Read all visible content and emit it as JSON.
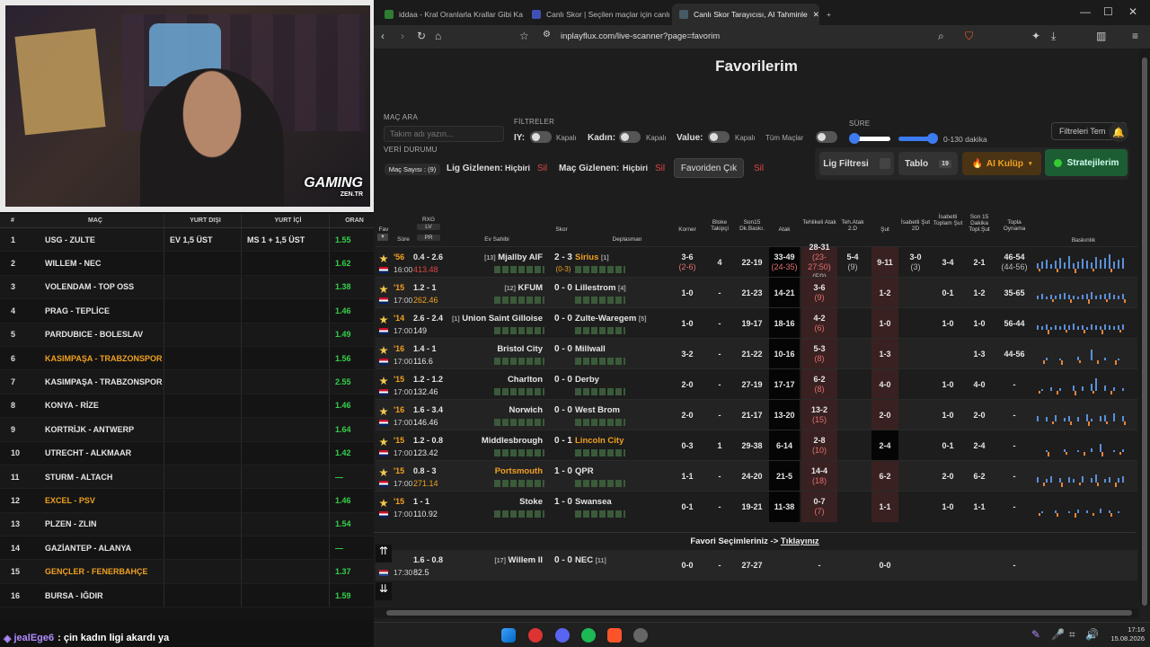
{
  "browser": {
    "tabs": [
      {
        "title": "iddaa - Kral Oranlarla Krallar Gibi Ka",
        "color": "#2e7d32"
      },
      {
        "title": "Canlı Skor | Seçilen maçlar için canlı",
        "color": "#3f51b5"
      },
      {
        "title": "Canlı Skor Tarayıcısı, AI Tahminle",
        "color": "#37474f"
      }
    ],
    "url": "inplayflux.com/live-scanner?page=favorim"
  },
  "left_table": {
    "headers": {
      "num": "#",
      "match": "MAÇ",
      "away": "YURT DIŞI",
      "home": "YURT İÇİ",
      "odds": "ORAN"
    },
    "rows": [
      {
        "n": "1",
        "match": "USG - ZULTE",
        "yd": "EV 1,5 ÜST",
        "yi": "MS 1 + 1,5 ÜST",
        "odd": "1.55",
        "hl": false
      },
      {
        "n": "2",
        "match": "WILLEM - NEC",
        "yd": "",
        "yi": "",
        "odd": "1.62",
        "hl": false
      },
      {
        "n": "3",
        "match": "VOLENDAM - TOP OSS",
        "yd": "",
        "yi": "",
        "odd": "1.38",
        "hl": false
      },
      {
        "n": "4",
        "match": "PRAG - TEPLİCE",
        "yd": "",
        "yi": "",
        "odd": "1.46",
        "hl": false
      },
      {
        "n": "5",
        "match": "PARDUBICE - BOLESLAV",
        "yd": "",
        "yi": "",
        "odd": "1.49",
        "hl": false
      },
      {
        "n": "6",
        "match": "KASIMPAŞA - TRABZONSPOR",
        "yd": "",
        "yi": "",
        "odd": "1.56",
        "hl": true
      },
      {
        "n": "7",
        "match": "KASIMPAŞA - TRABZONSPOR",
        "yd": "",
        "yi": "",
        "odd": "2.55",
        "hl": false
      },
      {
        "n": "8",
        "match": "KONYA - RİZE",
        "yd": "",
        "yi": "",
        "odd": "1.46",
        "hl": false
      },
      {
        "n": "9",
        "match": "KORTRİJK - ANTWERP",
        "yd": "",
        "yi": "",
        "odd": "1.64",
        "hl": false
      },
      {
        "n": "10",
        "match": "UTRECHT - ALKMAAR",
        "yd": "",
        "yi": "",
        "odd": "1.42",
        "hl": false
      },
      {
        "n": "11",
        "match": "STURM - ALTACH",
        "yd": "",
        "yi": "",
        "odd": "—",
        "hl": false
      },
      {
        "n": "12",
        "match": "EXCEL - PSV",
        "yd": "",
        "yi": "",
        "odd": "1.46",
        "hl": true
      },
      {
        "n": "13",
        "match": "PLZEN - ZLIN",
        "yd": "",
        "yi": "",
        "odd": "1.54",
        "hl": false
      },
      {
        "n": "14",
        "match": "GAZİANTEP - ALANYA",
        "yd": "",
        "yi": "",
        "odd": "—",
        "hl": false
      },
      {
        "n": "15",
        "match": "GENÇLER - FENERBAHÇE",
        "yd": "",
        "yi": "",
        "odd": "1.37",
        "hl": true
      },
      {
        "n": "16",
        "match": "BURSA - IĞDIR",
        "yd": "",
        "yi": "",
        "odd": "1.59",
        "hl": false
      }
    ]
  },
  "chat": {
    "user": "jealEge6",
    "message": ": çin kadın ligi akardı ya"
  },
  "page": {
    "title": "Favorilerim",
    "search_label": "MAÇ ARA",
    "search_placeholder": "Takım adı yazın...",
    "filters_label": "FİLTRELER",
    "filter_iy": "IY:",
    "filter_kadin": "Kadın:",
    "filter_value": "Value:",
    "off": "Kapalı",
    "all_matches": "Tüm Maçlar",
    "duration_label": "SÜRE",
    "duration_value": "0-130 dakika",
    "reset_filters": "Filtreleri Tem",
    "data_status": "VERİ DURUMU",
    "match_count": "Maç Sayısı : (9)",
    "league_hidden": "Lig Gizlenen:",
    "match_hidden": "Maç Gizlenen:",
    "none": "Hiçbiri",
    "delete": "Sil",
    "remove_fav": "Favoriden Çık",
    "league_filter": "Lig Filtresi",
    "table_btn": "Tablo",
    "table_count": "19",
    "ai_club": "AI Kulüp",
    "strategies": "Stratejilerim",
    "favorite_link_text": "Favori Seçimleriniz ->",
    "favorite_link": "Tıklayınız"
  },
  "columns": {
    "fav": "Fav",
    "sure": "Süre",
    "rxg": "RXG",
    "lv": "LV",
    "pr": "PR",
    "home": "Ev Sahibi",
    "score": "Skor",
    "away": "Deplasman",
    "corner": "Korner",
    "block": "Bloke Takipçi",
    "last15": "Son15 Dk.Baskı.",
    "attack": "Atak",
    "danger": "Tehlikeli Atak",
    "tehatak": "Teh.Atak 2.D",
    "shot": "Şut",
    "ontarget": "İsabetli Şut 2D",
    "ontotal": "İsabetli Toplam Şut",
    "last15shot": "Son 15 Dakika Topl.Şut",
    "possession": "Topla Oynama",
    "pressure": "Baskınlık"
  },
  "matches": [
    {
      "min": "'56",
      "time": "16:00",
      "rxg": "0.4 - 2.6",
      "rxgv": "413.48",
      "home": "Mjallby AIF",
      "hrank": "[13]",
      "score": "2 - 3",
      "ht": "(0-3)",
      "away": "Sirius",
      "arank": "[1]",
      "corner": "3-6",
      "corner2": "(2-6)",
      "block": "4",
      "last15": "22-19",
      "attack": "33-49",
      "attack2": "(24-35)",
      "danger": "28-31",
      "danger2": "(23-27:50)",
      "danger3": "(59)",
      "tehatak": "5-4",
      "tehatak2": "(9)",
      "shot": "9-11",
      "ontarget": "3-0",
      "ontarget2": "(3)",
      "ontotal": "3-4",
      "last15shot": "2-1",
      "poss": "46-54",
      "poss2": "(44-56)"
    },
    {
      "min": "'15",
      "time": "17:00",
      "rxg": "1.2 - 1",
      "rxgv": "262.46",
      "home": "KFUM",
      "hrank": "[12]",
      "score": "0 - 0",
      "ht": "",
      "away": "Lillestrom",
      "arank": "[4]",
      "corner": "1-0",
      "corner2": "",
      "block": "-",
      "last15": "21-23",
      "attack": "14-21",
      "attack2": "",
      "danger": "3-6",
      "danger2": "(9)",
      "danger3": "",
      "tehatak": "",
      "tehatak2": "",
      "shot": "1-2",
      "ontarget": "",
      "ontarget2": "",
      "ontotal": "0-1",
      "last15shot": "1-2",
      "poss": "35-65",
      "poss2": ""
    },
    {
      "min": "'14",
      "time": "17:00",
      "rxg": "2.6 - 2.4",
      "rxgv": "149",
      "home": "Union Saint Gilloise",
      "hrank": "[1]",
      "score": "0 - 0",
      "ht": "",
      "away": "Zulte-Waregem",
      "arank": "[5]",
      "corner": "1-0",
      "corner2": "",
      "block": "-",
      "last15": "19-17",
      "attack": "18-16",
      "attack2": "",
      "danger": "4-2",
      "danger2": "(6)",
      "danger3": "",
      "tehatak": "",
      "tehatak2": "",
      "shot": "1-0",
      "ontarget": "",
      "ontarget2": "",
      "ontotal": "1-0",
      "last15shot": "1-0",
      "poss": "56-44",
      "poss2": ""
    },
    {
      "min": "'16",
      "time": "17:00",
      "rxg": "1.4 - 1",
      "rxgv": "116.6",
      "home": "Bristol City",
      "hrank": "",
      "score": "0 - 0",
      "ht": "",
      "away": "Millwall",
      "arank": "",
      "corner": "3-2",
      "corner2": "",
      "block": "-",
      "last15": "21-22",
      "attack": "10-16",
      "attack2": "",
      "danger": "5-3",
      "danger2": "(8)",
      "danger3": "",
      "tehatak": "",
      "tehatak2": "",
      "shot": "1-3",
      "ontarget": "",
      "ontarget2": "",
      "ontotal": "",
      "last15shot": "1-3",
      "poss": "44-56",
      "poss2": ""
    },
    {
      "min": "'15",
      "time": "17:00",
      "rxg": "1.2 - 1.2",
      "rxgv": "132.46",
      "home": "Charlton",
      "hrank": "",
      "score": "0 - 0",
      "ht": "",
      "away": "Derby",
      "arank": "",
      "corner": "2-0",
      "corner2": "",
      "block": "-",
      "last15": "27-19",
      "attack": "17-17",
      "attack2": "",
      "danger": "6-2",
      "danger2": "(8)",
      "danger3": "",
      "tehatak": "",
      "tehatak2": "",
      "shot": "4-0",
      "ontarget": "",
      "ontarget2": "",
      "ontotal": "1-0",
      "last15shot": "4-0",
      "poss": "-",
      "poss2": ""
    },
    {
      "min": "'16",
      "time": "17:00",
      "rxg": "1.6 - 3.4",
      "rxgv": "146.46",
      "home": "Norwich",
      "hrank": "",
      "score": "0 - 0",
      "ht": "",
      "away": "West Brom",
      "arank": "",
      "corner": "2-0",
      "corner2": "",
      "block": "-",
      "last15": "21-17",
      "attack": "13-20",
      "attack2": "",
      "danger": "13-2",
      "danger2": "(15)",
      "danger3": "",
      "tehatak": "",
      "tehatak2": "",
      "shot": "2-0",
      "ontarget": "",
      "ontarget2": "",
      "ontotal": "1-0",
      "last15shot": "2-0",
      "poss": "-",
      "poss2": ""
    },
    {
      "min": "'15",
      "time": "17:00",
      "rxg": "1.2 - 0.8",
      "rxgv": "123.42",
      "home": "Middlesbrough",
      "hrank": "",
      "score": "0 - 1",
      "ht": "",
      "away": "Lincoln City",
      "arank": "",
      "corner": "0-3",
      "corner2": "",
      "block": "1",
      "last15": "29-38",
      "attack": "6-14",
      "attack2": "",
      "danger": "2-8",
      "danger2": "(10)",
      "danger3": "",
      "tehatak": "",
      "tehatak2": "",
      "shot": "2-4",
      "ontarget": "",
      "ontarget2": "",
      "ontotal": "0-1",
      "last15shot": "2-4",
      "poss": "-",
      "poss2": ""
    },
    {
      "min": "'15",
      "time": "17:00",
      "rxg": "0.8 - 3",
      "rxgv": "271.14",
      "home": "Portsmouth",
      "hrank": "",
      "score": "1 - 0",
      "ht": "",
      "away": "QPR",
      "arank": "",
      "corner": "1-1",
      "corner2": "",
      "block": "-",
      "last15": "24-20",
      "attack": "21-5",
      "attack2": "",
      "danger": "14-4",
      "danger2": "(18)",
      "danger3": "",
      "tehatak": "",
      "tehatak2": "",
      "shot": "6-2",
      "ontarget": "",
      "ontarget2": "",
      "ontotal": "2-0",
      "last15shot": "6-2",
      "poss": "-",
      "poss2": ""
    },
    {
      "min": "'15",
      "time": "17:00",
      "rxg": "1 - 1",
      "rxgv": "110.92",
      "home": "Stoke",
      "hrank": "",
      "score": "1 - 0",
      "ht": "",
      "away": "Swansea",
      "arank": "",
      "corner": "0-1",
      "corner2": "",
      "block": "-",
      "last15": "19-21",
      "attack": "11-38",
      "attack2": "",
      "danger": "0-7",
      "danger2": "(7)",
      "danger3": "",
      "tehatak": "",
      "tehatak2": "",
      "shot": "1-1",
      "ontarget": "",
      "ontarget2": "",
      "ontotal": "1-0",
      "last15shot": "1-1",
      "poss": "-",
      "poss2": ""
    }
  ],
  "extra_match": {
    "min": "",
    "time": "17:30",
    "rxg": "1.6 - 0.8",
    "rxgv": "82.5",
    "home": "Willem II",
    "hrank": "[17]",
    "score": "0 - 0",
    "away": "NEC",
    "arank": "[11]",
    "corner": "0-0",
    "block": "-",
    "last15": "27-27",
    "attack": "",
    "danger": "-",
    "shot": "0-0",
    "poss": "-"
  },
  "taskbar": {
    "time": "17:16",
    "date": "15.08.2026"
  }
}
